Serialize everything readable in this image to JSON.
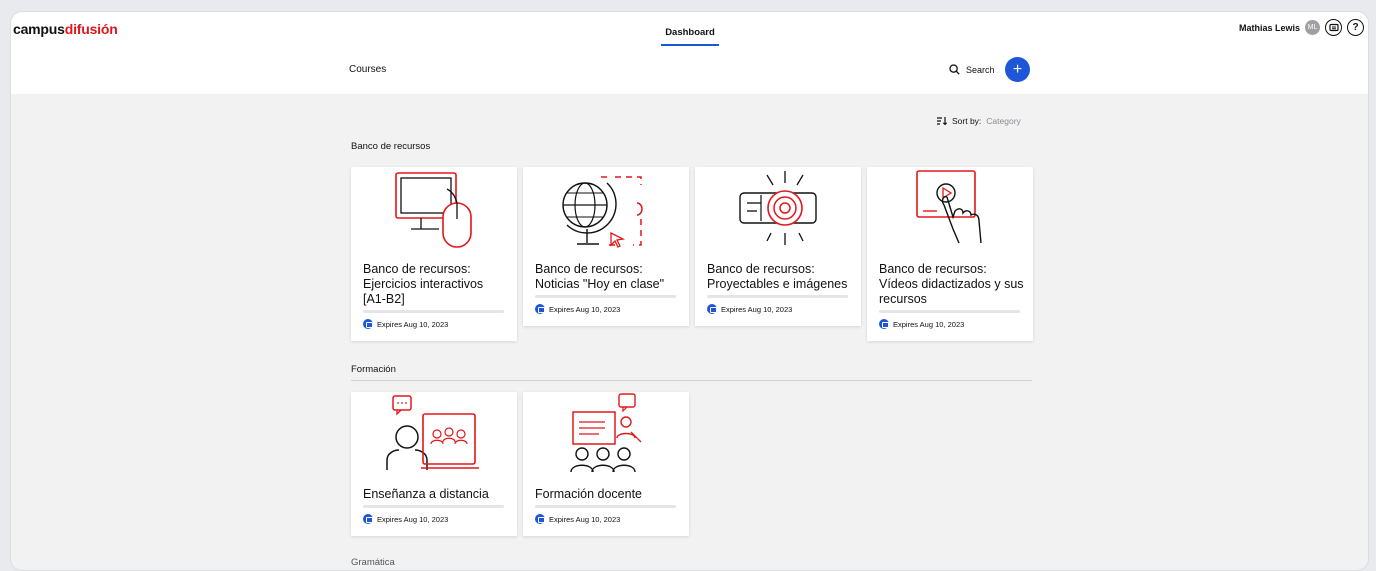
{
  "brand": {
    "part1": "campus",
    "part2": "difusión",
    "accent": "#e3161b"
  },
  "nav": {
    "active_tab": "Dashboard"
  },
  "user": {
    "name": "Mathias Lewis",
    "initials": "ML"
  },
  "toolbar": {
    "courses_label": "Courses",
    "search_label": "Search",
    "add_label": "+"
  },
  "sort": {
    "label": "Sort by:",
    "value": "Category"
  },
  "sections": [
    {
      "title": "Banco de recursos",
      "cards": [
        {
          "title": "Banco de recursos: Ejercicios interactivos [A1-B2]",
          "expires": "Expires Aug 10, 2023",
          "icon": "computer-mouse-icon"
        },
        {
          "title": "Banco de recursos: Noticias \"Hoy en clase\"",
          "expires": "Expires Aug 10, 2023",
          "icon": "globe-icon"
        },
        {
          "title": "Banco de recursos: Proyectables e imágenes",
          "expires": "Expires Aug 10, 2023",
          "icon": "projector-icon"
        },
        {
          "title": "Banco de recursos: Vídeos didactizados y sus recursos",
          "expires": "Expires Aug 10, 2023",
          "icon": "video-touch-icon"
        }
      ]
    },
    {
      "title": "Formación",
      "cards": [
        {
          "title": "Enseñanza a distancia",
          "expires": "Expires Aug 10, 2023",
          "icon": "remote-teaching-icon"
        },
        {
          "title": "Formación docente",
          "expires": "Expires Aug 10, 2023",
          "icon": "teacher-training-icon"
        }
      ]
    },
    {
      "title": "Gramática"
    }
  ],
  "colors": {
    "primary": "#1d57d8",
    "illustration_red": "#e3161b"
  }
}
